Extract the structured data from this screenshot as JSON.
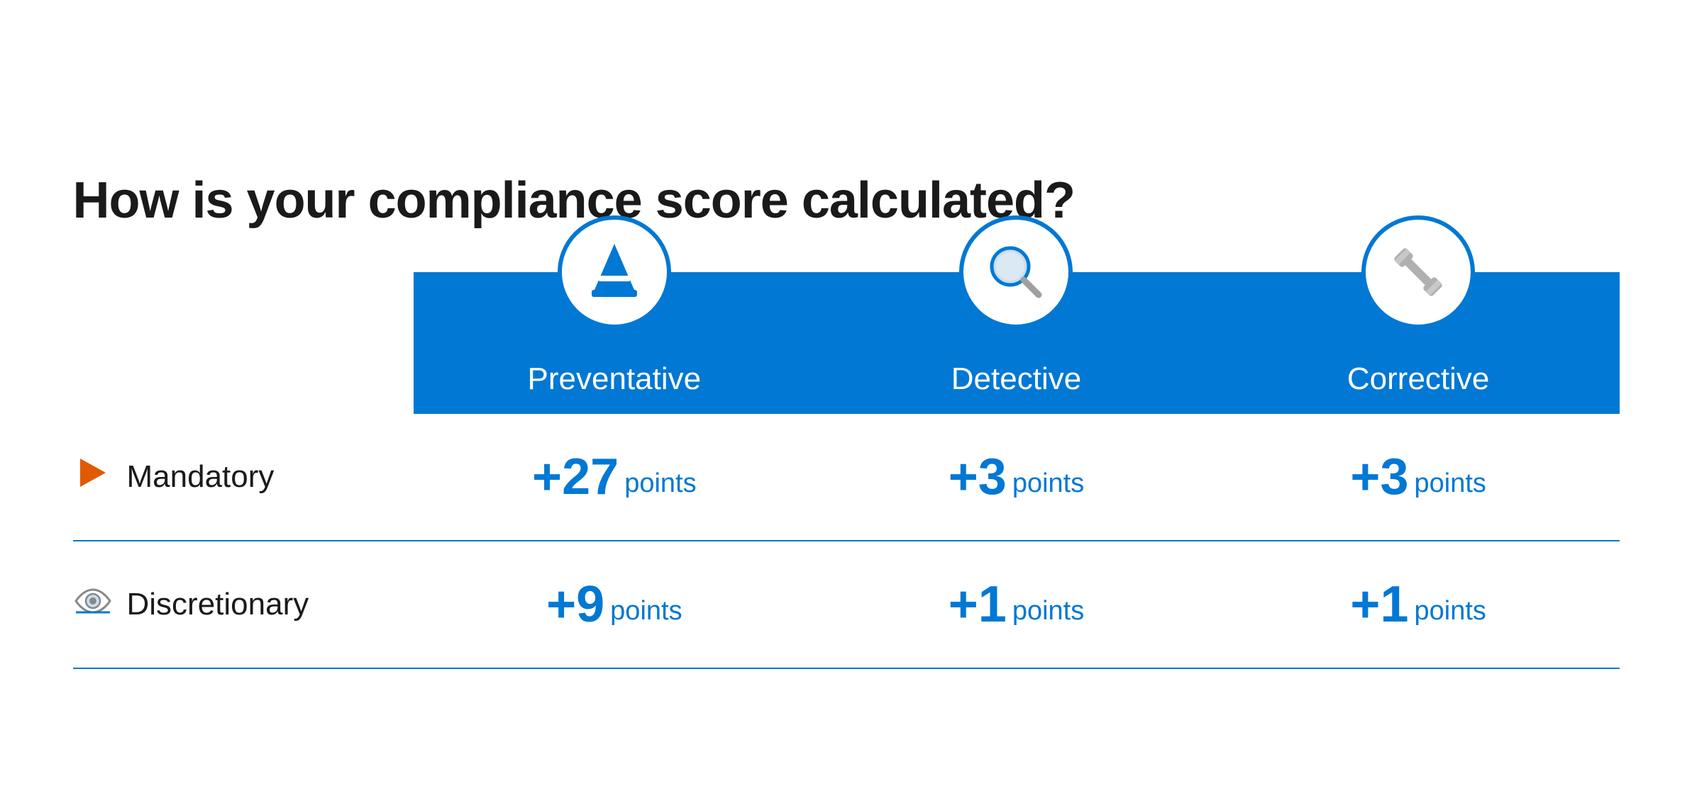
{
  "title": "How is your compliance score calculated?",
  "columns": [
    {
      "id": "preventative",
      "label": "Preventative",
      "icon": "cone"
    },
    {
      "id": "detective",
      "label": "Detective",
      "icon": "magnifier"
    },
    {
      "id": "corrective",
      "label": "Corrective",
      "icon": "wrench"
    }
  ],
  "rows": [
    {
      "id": "mandatory",
      "label": "Mandatory",
      "icon": "flag",
      "values": [
        "+27",
        "+3",
        "+3"
      ],
      "unit": "points"
    },
    {
      "id": "discretionary",
      "label": "Discretionary",
      "icon": "eye",
      "values": [
        "+9",
        "+1",
        "+1"
      ],
      "unit": "points"
    }
  ]
}
